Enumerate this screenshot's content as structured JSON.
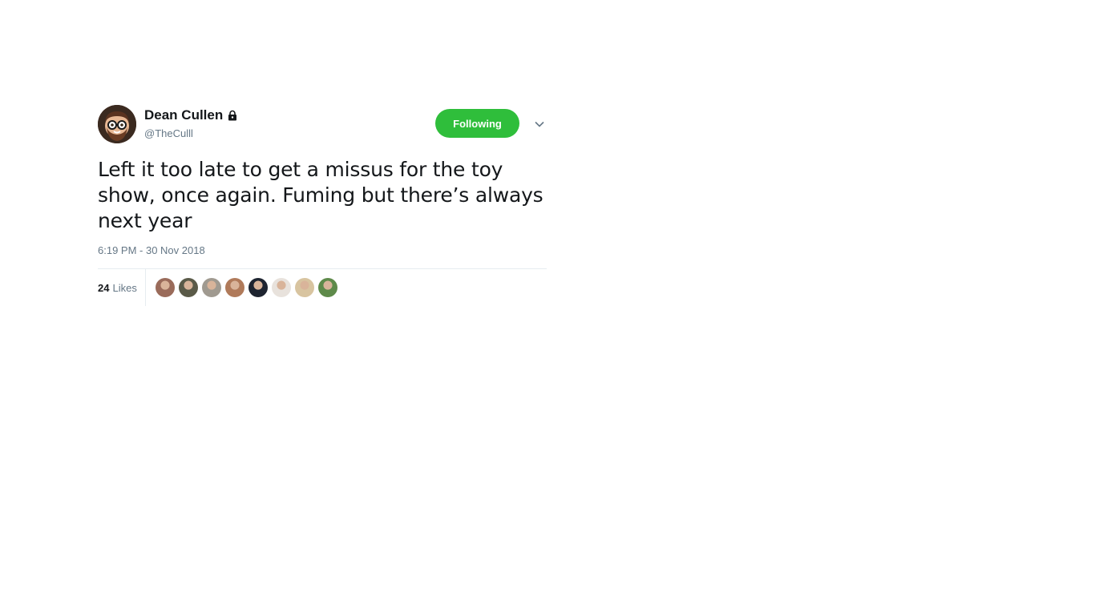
{
  "tweet": {
    "author": {
      "name": "Dean Cullen",
      "handle": "@TheCulll",
      "protected_icon": "lock-icon"
    },
    "follow_button_label": "Following",
    "follow_button_color": "#2fbe3b",
    "menu_icon": "chevron-down-icon",
    "text": "Left it too late to get a missus for the toy show, once again. Fuming but there’s always next year",
    "timestamp": "6:19 PM - 30 Nov 2018",
    "likes": {
      "count": "24",
      "label": "Likes"
    },
    "likers": [
      {
        "name": "liker-avatar-1",
        "color": "#9a6b5a"
      },
      {
        "name": "liker-avatar-2",
        "color": "#5a5a48"
      },
      {
        "name": "liker-avatar-3",
        "color": "#a09a90"
      },
      {
        "name": "liker-avatar-4",
        "color": "#b07a5a"
      },
      {
        "name": "liker-avatar-5",
        "color": "#1e2430"
      },
      {
        "name": "liker-avatar-6",
        "color": "#e8e2dc"
      },
      {
        "name": "liker-avatar-7",
        "color": "#d8c4a0"
      },
      {
        "name": "liker-avatar-8",
        "color": "#5e8a4a"
      }
    ]
  }
}
